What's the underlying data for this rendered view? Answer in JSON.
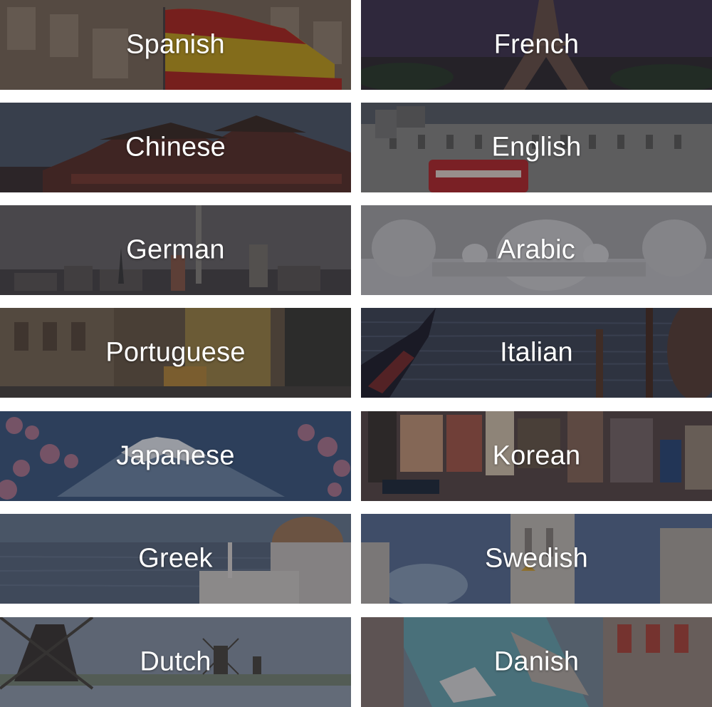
{
  "languages": [
    {
      "label": "Spanish",
      "scene": "spanish-flag-building-image"
    },
    {
      "label": "French",
      "scene": "eiffel-tower-image"
    },
    {
      "label": "Chinese",
      "scene": "forbidden-city-image"
    },
    {
      "label": "English",
      "scene": "london-bus-building-image"
    },
    {
      "label": "German",
      "scene": "berlin-skyline-image"
    },
    {
      "label": "Arabic",
      "scene": "white-mosque-image"
    },
    {
      "label": "Portuguese",
      "scene": "lisbon-tram-street-image"
    },
    {
      "label": "Italian",
      "scene": "venice-gondola-image"
    },
    {
      "label": "Japanese",
      "scene": "mount-fuji-blossom-image"
    },
    {
      "label": "Korean",
      "scene": "seoul-signs-street-image"
    },
    {
      "label": "Greek",
      "scene": "santorini-dome-image"
    },
    {
      "label": "Swedish",
      "scene": "stockholm-towers-image"
    },
    {
      "label": "Dutch",
      "scene": "windmills-image"
    },
    {
      "label": "Danish",
      "scene": "copenhagen-harbor-image"
    }
  ]
}
